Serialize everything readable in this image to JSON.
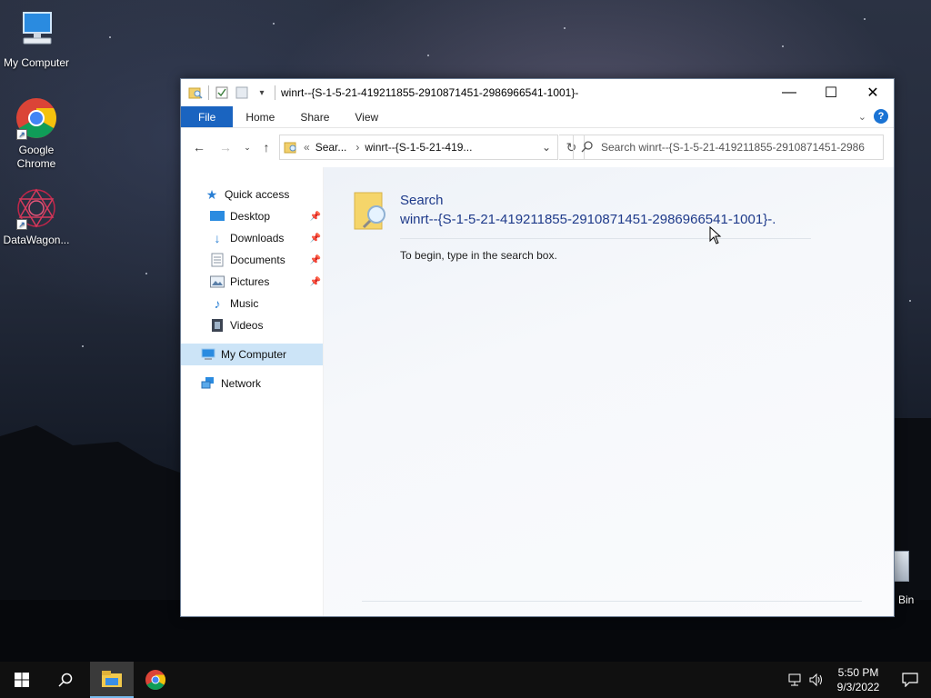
{
  "desktop": {
    "icons": [
      {
        "label": "My Computer"
      },
      {
        "label": "Google Chrome"
      },
      {
        "label": "DataWagon..."
      }
    ],
    "recycle_bin_label": "Bin"
  },
  "window": {
    "title": "winrt--{S-1-5-21-419211855-2910871451-2986966541-1001}-",
    "controls": {
      "minimize": "—",
      "maximize": "☐",
      "close": "✕"
    },
    "ribbon": {
      "tabs": [
        {
          "label": "File"
        },
        {
          "label": "Home"
        },
        {
          "label": "Share"
        },
        {
          "label": "View"
        }
      ],
      "help": "?"
    },
    "address": {
      "prefix": "«",
      "crumbs": [
        "Sear...",
        "winrt--{S-1-5-21-419..."
      ]
    },
    "search": {
      "placeholder": "Search winrt--{S-1-5-21-419211855-2910871451-2986"
    },
    "sidebar": {
      "quick_access": "Quick access",
      "items": [
        {
          "label": "Desktop",
          "pinned": true
        },
        {
          "label": "Downloads",
          "pinned": true
        },
        {
          "label": "Documents",
          "pinned": true
        },
        {
          "label": "Pictures",
          "pinned": true
        },
        {
          "label": "Music",
          "pinned": false
        },
        {
          "label": "Videos",
          "pinned": false
        }
      ],
      "my_computer": "My Computer",
      "network": "Network"
    },
    "content": {
      "heading_line1": "Search",
      "heading_line2": "winrt--{S-1-5-21-419211855-2910871451-2986966541-1001}-.",
      "hint": "To begin, type in the search box."
    }
  },
  "taskbar": {
    "clock_time": "5:50 PM",
    "clock_date": "9/3/2022"
  },
  "colors": {
    "accent": "#1a64c0",
    "selection": "#cce4f7",
    "link_text": "#1e3a8a",
    "taskbar": "#101010"
  }
}
